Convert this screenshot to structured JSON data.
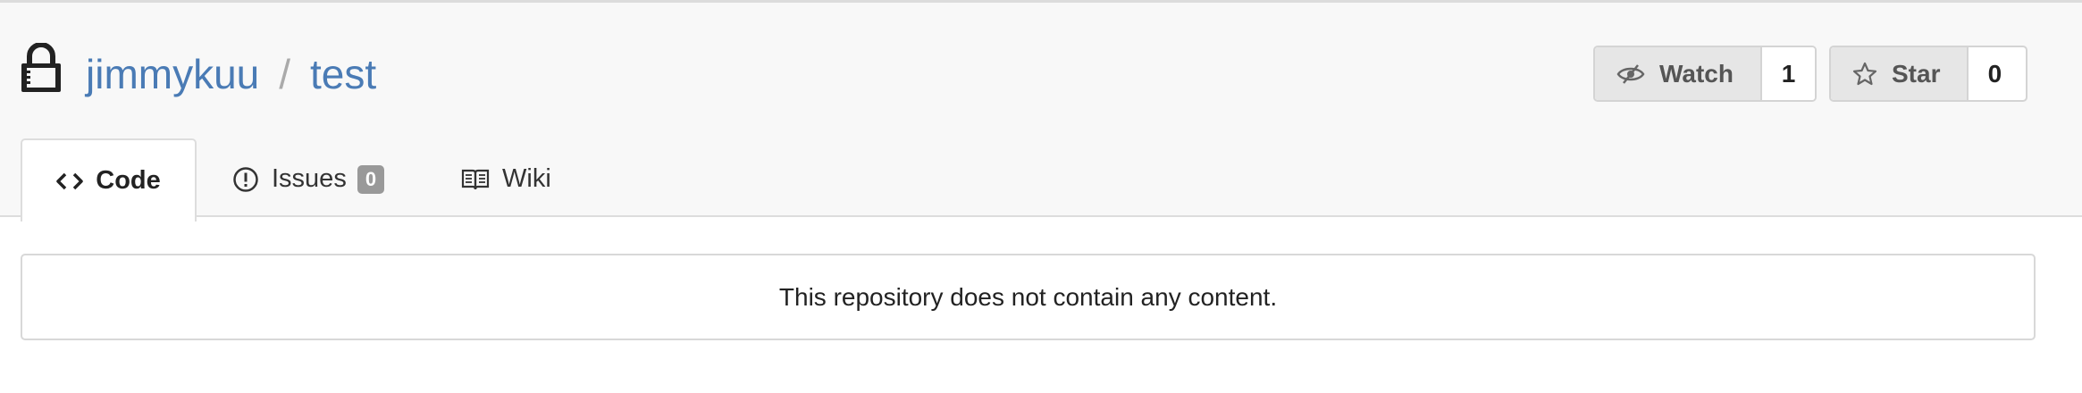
{
  "repo": {
    "owner": "jimmykuu",
    "separator": "/",
    "name": "test",
    "private_icon": "lock-icon"
  },
  "actions": {
    "watch": {
      "label": "Watch",
      "count": "1",
      "icon": "eye-slash-icon"
    },
    "star": {
      "label": "Star",
      "count": "0",
      "icon": "star-icon"
    }
  },
  "tabs": [
    {
      "label": "Code",
      "icon": "code-icon",
      "active": true
    },
    {
      "label": "Issues",
      "icon": "issue-icon",
      "badge": "0",
      "active": false
    },
    {
      "label": "Wiki",
      "icon": "book-icon",
      "active": false
    }
  ],
  "main": {
    "empty_message": "This repository does not contain any content."
  }
}
